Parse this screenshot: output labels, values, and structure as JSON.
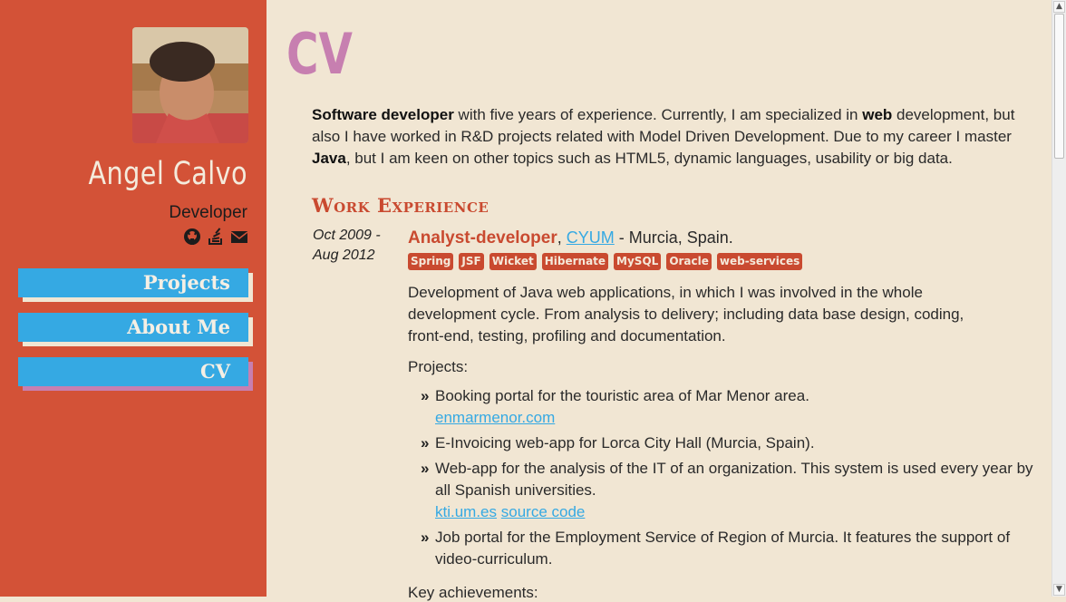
{
  "sidebar": {
    "name": "Angel Calvo",
    "role": "Developer",
    "nav": [
      {
        "label": "Projects"
      },
      {
        "label": "About Me"
      },
      {
        "label": "CV"
      }
    ],
    "social_icons": [
      "github-icon",
      "stackoverflow-icon",
      "envelope-icon"
    ],
    "colors": {
      "background": "#d35237",
      "nav": "#35a9e3",
      "shadow_default": "#f1e6d3",
      "shadow_active": "#c77fb0"
    }
  },
  "main": {
    "title": "CV",
    "intro": {
      "b1": "Software developer",
      "t1": " with five years of experience. Currently, I am specialized in ",
      "b2": "web",
      "t2": " development, but also I have worked in R&D projects related with Model Driven Development. Due to my career I master ",
      "b3": "Java",
      "t3": ", but I am keen on other topics such as HTML5, dynamic languages, usability or big data."
    },
    "section_title": "Work Experience",
    "job": {
      "dates": "Oct 2009 - Aug 2012",
      "title": "Analyst-developer",
      "comma": ",",
      "company": "CYUM",
      "location": " - Murcia, Spain.",
      "tags": [
        "Spring",
        "JSF",
        "Wicket",
        "Hibernate",
        "MySQL",
        "Oracle",
        "web-services"
      ],
      "description": "Development of Java web applications, in which I was involved in the whole development cycle. From analysis to delivery; including data base design, coding, front-end, testing, profiling and documentation.",
      "projects_label": "Projects:",
      "projects": [
        {
          "text": "Booking portal for the touristic area of Mar Menor area.",
          "links": [
            "enmarmenor.com"
          ]
        },
        {
          "text": "E-Invoicing web-app for Lorca City Hall (Murcia, Spain).",
          "links": []
        },
        {
          "text": "Web-app for the analysis of the IT of an organization. This system is used every year by all Spanish universities.",
          "links": [
            "kti.um.es",
            "source code"
          ]
        },
        {
          "text": "Job portal for the Employment Service of Region of Murcia. It features the support of video-curriculum.",
          "links": []
        }
      ],
      "key_label": "Key achievements:"
    }
  },
  "colors": {
    "page_bg": "#f1e6d3",
    "accent_red": "#c94a30",
    "title_pink": "#c77fb0",
    "link": "#35a9e3"
  }
}
